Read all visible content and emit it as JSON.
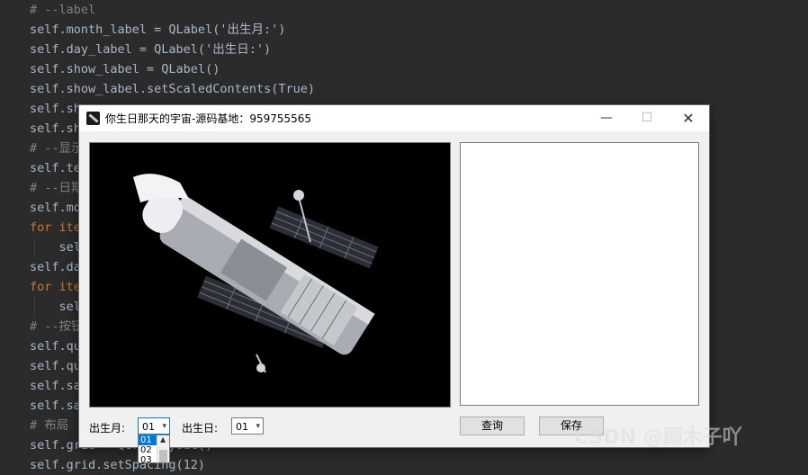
{
  "code_editor": {
    "lines": [
      {
        "text": "# --label",
        "color": "#808080"
      },
      {
        "text": "self.month_label = QLabel('出生月:')",
        "color": "#a9b7c6"
      },
      {
        "text": "self.day_label = QLabel('出生日:')",
        "color": "#a9b7c6"
      },
      {
        "text": "self.show_label = QLabel()",
        "color": "#a9b7c6"
      },
      {
        "text": "self.show_label.setScaledContents(True)",
        "color": "#a9b7c6"
      },
      {
        "text": "self.sh",
        "color": "#a9b7c6"
      },
      {
        "text": "self.sh",
        "color": "#a9b7c6"
      },
      {
        "text": "# --显示",
        "color": "#808080"
      },
      {
        "text": "self.te",
        "color": "#a9b7c6"
      },
      {
        "text": "# --日期",
        "color": "#808080"
      },
      {
        "text": "self.mo",
        "color": "#a9b7c6"
      },
      {
        "text": "for ite",
        "color": "#cc7832"
      },
      {
        "text": "    sel",
        "color": "#a9b7c6"
      },
      {
        "text": "self.da",
        "color": "#a9b7c6"
      },
      {
        "text": "for ite",
        "color": "#cc7832"
      },
      {
        "text": "    sel",
        "color": "#a9b7c6"
      },
      {
        "text": "# --按钮",
        "color": "#808080"
      },
      {
        "text": "self.qu",
        "color": "#a9b7c6"
      },
      {
        "text": "self.qu",
        "color": "#a9b7c6"
      },
      {
        "text": "self.sa",
        "color": "#a9b7c6"
      },
      {
        "text": "self.sa",
        "color": "#a9b7c6"
      },
      {
        "text": "# 布局",
        "color": "#808080"
      },
      {
        "text": "self.grid = QGridLayout()",
        "color": "#a9b7c6"
      },
      {
        "text": "self.grid.setSpacing(12)",
        "color": "#a9b7c6"
      }
    ]
  },
  "window": {
    "title": "你生日那天的宇宙-源码基地：959755565",
    "minimize_glyph": "—",
    "maximize_glyph": "☐",
    "close_glyph": "✕"
  },
  "form": {
    "month_label": "出生月:",
    "day_label": "出生日:",
    "month_value": "01",
    "day_value": "01",
    "month_options": [
      "01",
      "02",
      "03"
    ],
    "query_button": "查询",
    "save_button": "保存"
  },
  "watermark": "CSDN @顾木子吖",
  "icons": {
    "app": "app-icon",
    "dropdown_arrow": "chevron-down-icon"
  },
  "colors": {
    "editor_bg": "#2b2b2b",
    "window_bg": "#f0f0f0",
    "accent": "#0078d7"
  }
}
